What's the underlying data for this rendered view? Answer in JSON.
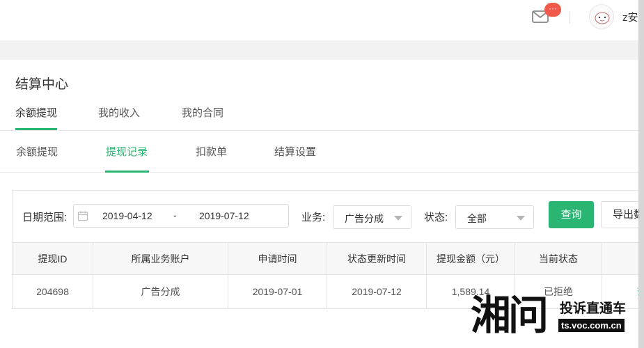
{
  "header": {
    "mail_icon": "mail-icon",
    "notification_badge": "···",
    "username": "z安淳",
    "colors": {
      "badge": "#f15a4a"
    }
  },
  "page": {
    "title": "结算中心"
  },
  "main_tabs": [
    "余额提现",
    "我的收入",
    "我的合同"
  ],
  "sub_tabs": [
    "余额提现",
    "提现记录",
    "扣款单",
    "结算设置"
  ],
  "filters": {
    "date_label": "日期范围:",
    "date_start": "2019-04-12",
    "date_separator": "-",
    "date_end": "2019-07-12",
    "business_label": "业务:",
    "business_value": "广告分成",
    "status_label": "状态:",
    "status_value": "全部",
    "query_button": "查询",
    "export_button": "导出数据"
  },
  "table": {
    "columns": [
      "提现ID",
      "所属业务账户",
      "申请时间",
      "状态更新时间",
      "提现金额（元）",
      "当前状态",
      ""
    ],
    "rows": [
      [
        "204698",
        "广告分成",
        "2019-07-01",
        "2019-07-12",
        "1,589.14",
        "已拒绝",
        "查看"
      ]
    ]
  },
  "watermark": {
    "logo": "湘问",
    "slogan": "投诉直通车",
    "url": "ts.voc.com.cn"
  },
  "colors": {
    "accent": "#2bb573"
  }
}
